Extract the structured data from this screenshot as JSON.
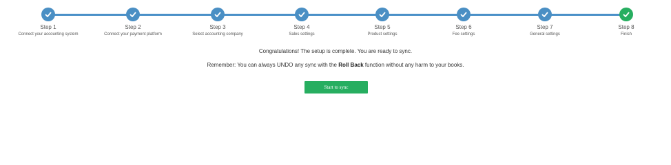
{
  "stepper": {
    "steps": [
      {
        "label": "Step 1",
        "desc": "Connect your accounting system",
        "status": "complete"
      },
      {
        "label": "Step 2",
        "desc": "Connect your payment platform",
        "status": "complete"
      },
      {
        "label": "Step 3",
        "desc": "Select accounting company",
        "status": "complete"
      },
      {
        "label": "Step 4",
        "desc": "Sales settings",
        "status": "complete"
      },
      {
        "label": "Step 5",
        "desc": "Product settings",
        "status": "complete"
      },
      {
        "label": "Step 6",
        "desc": "Fee settings",
        "status": "complete"
      },
      {
        "label": "Step 7",
        "desc": "General settings",
        "status": "complete"
      },
      {
        "label": "Step 8",
        "desc": "Finish",
        "status": "current-complete"
      }
    ],
    "colors": {
      "track": "#4a90c8",
      "step_complete": "#4a8fc4",
      "step_final": "#27ae60"
    },
    "step_icon": "checkmark-icon"
  },
  "content": {
    "message": "Congratulations! The setup is complete. You are ready to sync.",
    "reminder_prefix": "Remember: You can always UNDO any sync with the ",
    "reminder_bold": "Roll Back",
    "reminder_suffix": " function without any harm to your books.",
    "button_label": "Start to sync",
    "button_color": "#27ae60"
  }
}
